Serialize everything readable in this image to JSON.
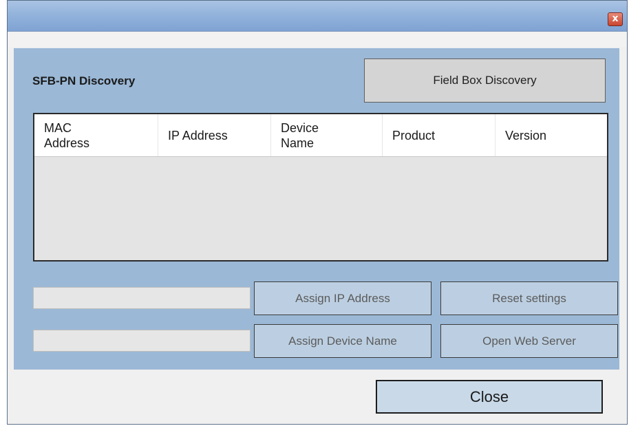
{
  "window": {
    "close_glyph": "x"
  },
  "panel": {
    "title": "SFB-PN Discovery",
    "field_box_discovery_label": "Field Box Discovery"
  },
  "table": {
    "columns": [
      "MAC Address",
      "IP Address",
      "Device Name",
      "Product",
      "Version"
    ],
    "rows": []
  },
  "actions": {
    "assign_ip_label": "Assign IP Address",
    "reset_settings_label": "Reset settings",
    "assign_device_name_label": "Assign Device Name",
    "open_web_server_label": "Open Web Server",
    "ip_input_value": "",
    "device_name_input_value": ""
  },
  "footer": {
    "close_label": "Close"
  },
  "colors": {
    "panel_bg": "#9bb8d6",
    "titlebar": "#8fb0da",
    "button_bg": "#bccfe2"
  }
}
